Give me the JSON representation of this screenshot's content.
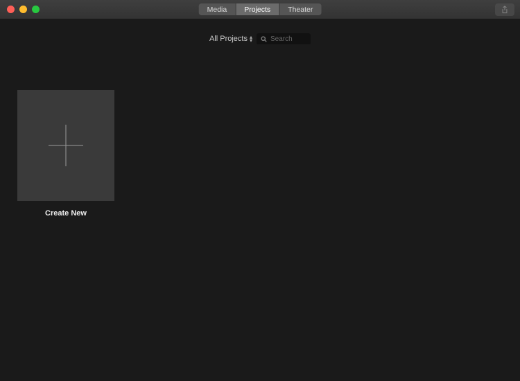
{
  "tabs": {
    "media": "Media",
    "projects": "Projects",
    "theater": "Theater"
  },
  "subbar": {
    "filter_label": "All Projects",
    "search_placeholder": "Search"
  },
  "tiles": {
    "create_new_label": "Create New"
  }
}
